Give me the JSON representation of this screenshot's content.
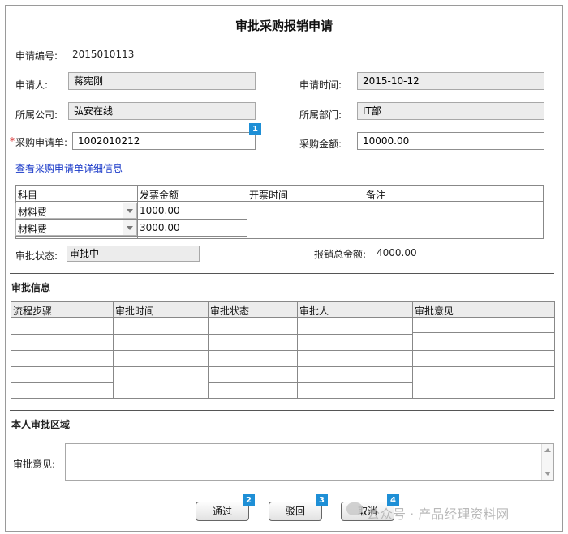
{
  "title": "审批采购报销申请",
  "application": {
    "no_label": "申请编号:",
    "no_value": "2015010113",
    "applicant_label": "申请人:",
    "applicant_value": "蒋宪刚",
    "apply_time_label": "申请时间:",
    "apply_time_value": "2015-10-12",
    "company_label": "所属公司:",
    "company_value": "弘安在线",
    "dept_label": "所属部门:",
    "dept_value": "IT部",
    "po_required_mark": "*",
    "po_label": "采购申请单:",
    "po_value": "1002010212",
    "amount_label": "采购金额:",
    "amount_value": "10000.00",
    "link_text": "查看采购申请单详细信息"
  },
  "invoice_table": {
    "headers": [
      "科目",
      "发票金额",
      "开票时间",
      "备注"
    ],
    "rows": [
      {
        "subject": "材料费",
        "amount": "1000.00",
        "time": "",
        "note": ""
      },
      {
        "subject": "材料费",
        "amount": "3000.00",
        "time": "",
        "note": ""
      }
    ]
  },
  "status": {
    "label": "审批状态:",
    "value": "审批中",
    "total_label": "报销总金额:",
    "total_value": "4000.00"
  },
  "approval_info": {
    "section_title": "审批信息",
    "headers": [
      "流程步骤",
      "审批时间",
      "审批状态",
      "审批人",
      "审批意见"
    ]
  },
  "my_approval": {
    "section_title": "本人审批区域",
    "opinion_label": "审批意见:",
    "opinion_value": ""
  },
  "buttons": {
    "approve": "通过",
    "reject": "驳回",
    "cancel": "取消"
  },
  "badges": [
    "1",
    "2",
    "3",
    "4"
  ],
  "watermark": "公众号 · 产品经理资料网",
  "colors": {
    "badge": "#1e8fd6",
    "link": "#1838c8",
    "required": "#d01010"
  }
}
